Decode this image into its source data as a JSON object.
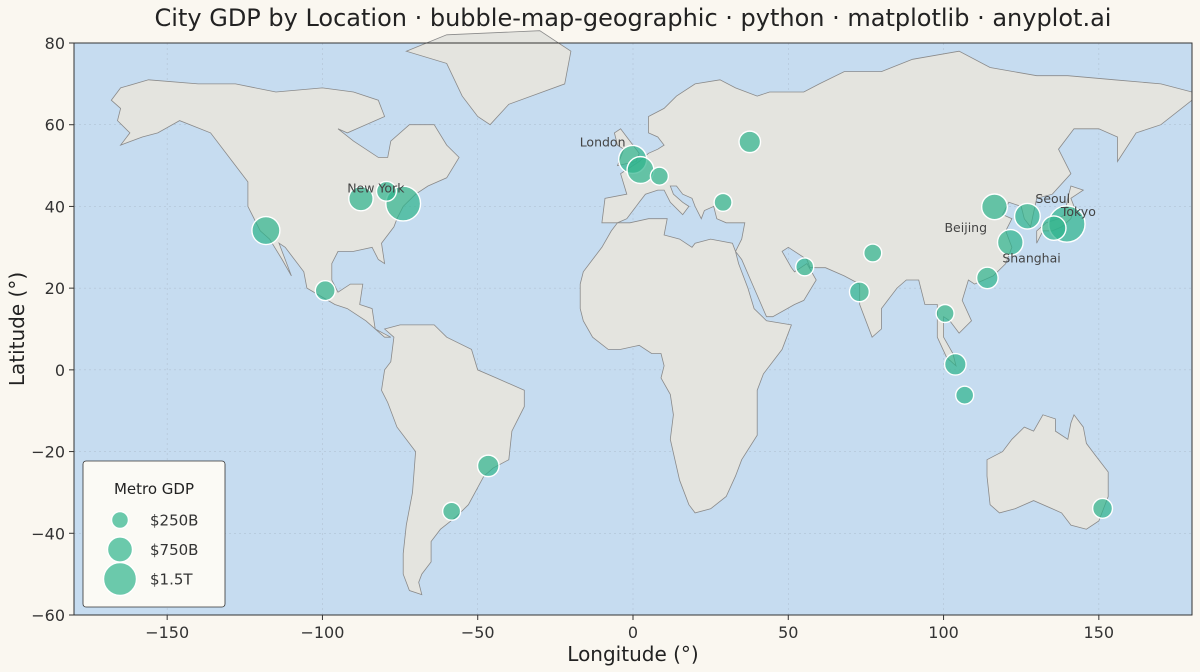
{
  "chart_data": {
    "type": "scatter",
    "title": "City GDP by Location · bubble-map-geographic · python · matplotlib · anyplot.ai",
    "xlabel": "Longitude (°)",
    "ylabel": "Latitude (°)",
    "xlim": [
      -180,
      180
    ],
    "ylim": [
      -60,
      80
    ],
    "xticks": [
      -150,
      -100,
      -50,
      0,
      50,
      100,
      150
    ],
    "yticks": [
      -60,
      -40,
      -20,
      0,
      20,
      40,
      60,
      80
    ],
    "grid": true,
    "colors": {
      "bubble": "#2db38c",
      "ocean": "#c6dcf0",
      "land": "#e4e4df",
      "background": "#faf7f0"
    },
    "cities": [
      {
        "name": "Tokyo",
        "lon": 139.7,
        "lat": 35.7,
        "gdp": 1.9,
        "label": "Tokyo"
      },
      {
        "name": "New York",
        "lon": -74.0,
        "lat": 40.7,
        "gdp": 1.7,
        "label": "New York"
      },
      {
        "name": "Los Angeles",
        "lon": -118.2,
        "lat": 34.1,
        "gdp": 1.0,
        "label": ""
      },
      {
        "name": "Seoul",
        "lon": 127.0,
        "lat": 37.6,
        "gdp": 0.8,
        "label": "Seoul"
      },
      {
        "name": "Osaka",
        "lon": 135.5,
        "lat": 34.7,
        "gdp": 0.7,
        "label": ""
      },
      {
        "name": "Shanghai",
        "lon": 121.5,
        "lat": 31.2,
        "gdp": 0.8,
        "label": "Shanghai"
      },
      {
        "name": "Beijing",
        "lon": 116.4,
        "lat": 39.9,
        "gdp": 0.8,
        "label": "Beijing"
      },
      {
        "name": "London",
        "lon": -0.1,
        "lat": 51.5,
        "gdp": 1.0,
        "label": "London"
      },
      {
        "name": "Paris",
        "lon": 2.4,
        "lat": 48.9,
        "gdp": 0.9,
        "label": ""
      },
      {
        "name": "Chicago",
        "lon": -87.6,
        "lat": 41.9,
        "gdp": 0.7,
        "label": ""
      },
      {
        "name": "Toronto",
        "lon": -79.4,
        "lat": 43.7,
        "gdp": 0.4,
        "label": ""
      },
      {
        "name": "Moscow",
        "lon": 37.6,
        "lat": 55.8,
        "gdp": 0.5,
        "label": ""
      },
      {
        "name": "Istanbul",
        "lon": 29.0,
        "lat": 41.0,
        "gdp": 0.3,
        "label": ""
      },
      {
        "name": "Zurich",
        "lon": 8.5,
        "lat": 47.4,
        "gdp": 0.3,
        "label": ""
      },
      {
        "name": "Dubai",
        "lon": 55.3,
        "lat": 25.2,
        "gdp": 0.3,
        "label": ""
      },
      {
        "name": "Mumbai",
        "lon": 72.9,
        "lat": 19.1,
        "gdp": 0.4,
        "label": ""
      },
      {
        "name": "Delhi",
        "lon": 77.2,
        "lat": 28.6,
        "gdp": 0.3,
        "label": ""
      },
      {
        "name": "Shenzhen",
        "lon": 114.1,
        "lat": 22.5,
        "gdp": 0.5,
        "label": ""
      },
      {
        "name": "Bangkok",
        "lon": 100.5,
        "lat": 13.8,
        "gdp": 0.3,
        "label": ""
      },
      {
        "name": "Singapore",
        "lon": 103.8,
        "lat": 1.35,
        "gdp": 0.5,
        "label": ""
      },
      {
        "name": "Jakarta",
        "lon": 106.8,
        "lat": -6.2,
        "gdp": 0.3,
        "label": ""
      },
      {
        "name": "Mexico City",
        "lon": -99.1,
        "lat": 19.4,
        "gdp": 0.4,
        "label": ""
      },
      {
        "name": "São Paulo",
        "lon": -46.6,
        "lat": -23.5,
        "gdp": 0.5,
        "label": ""
      },
      {
        "name": "Buenos Aires",
        "lon": -58.4,
        "lat": -34.6,
        "gdp": 0.3,
        "label": ""
      },
      {
        "name": "Sydney",
        "lon": 151.2,
        "lat": -33.9,
        "gdp": 0.4,
        "label": ""
      }
    ],
    "legend": {
      "title": "Metro GDP",
      "position": "lower-left",
      "entries": [
        {
          "label": "$250B",
          "gdp": 0.25
        },
        {
          "label": "$750B",
          "gdp": 0.75
        },
        {
          "label": "$1.5T",
          "gdp": 1.5
        }
      ]
    }
  }
}
